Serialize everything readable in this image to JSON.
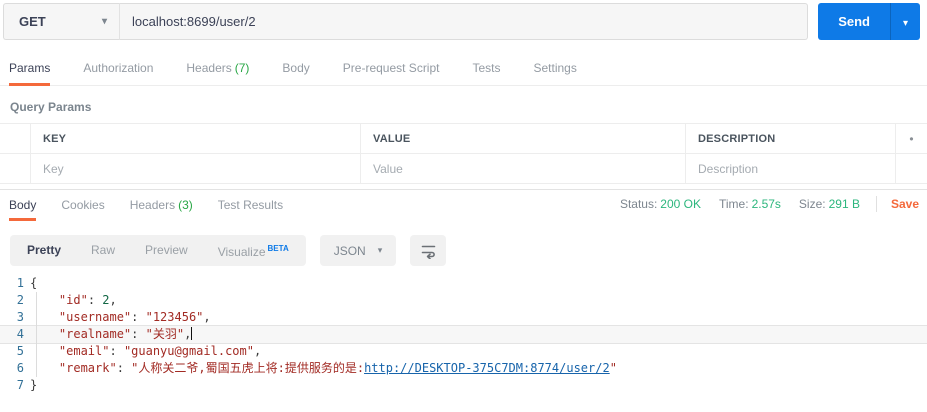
{
  "request": {
    "method": "GET",
    "url": "localhost:8699/user/2",
    "send_label": "Send",
    "tabs": [
      {
        "label": "Params",
        "active": true
      },
      {
        "label": "Authorization"
      },
      {
        "label": "Headers",
        "count": "(7)"
      },
      {
        "label": "Body"
      },
      {
        "label": "Pre-request Script"
      },
      {
        "label": "Tests"
      },
      {
        "label": "Settings"
      }
    ]
  },
  "query_params": {
    "title": "Query Params",
    "columns": {
      "key": "KEY",
      "value": "VALUE",
      "description": "DESCRIPTION"
    },
    "placeholders": {
      "key": "Key",
      "value": "Value",
      "description": "Description"
    },
    "more_icon": "•"
  },
  "response": {
    "tabs": [
      {
        "label": "Body",
        "active": true
      },
      {
        "label": "Cookies"
      },
      {
        "label": "Headers",
        "count": "(3)"
      },
      {
        "label": "Test Results"
      }
    ],
    "meta": {
      "status_label": "Status:",
      "status_value": "200 OK",
      "time_label": "Time:",
      "time_value": "2.57s",
      "size_label": "Size:",
      "size_value": "291 B",
      "save_label": "Save"
    },
    "toolbar": {
      "views": [
        {
          "label": "Pretty",
          "active": true
        },
        {
          "label": "Raw"
        },
        {
          "label": "Preview"
        },
        {
          "label": "Visualize",
          "beta": "BETA"
        }
      ],
      "language": "JSON"
    },
    "code": {
      "lines": [
        {
          "n": 1,
          "tokens": [
            {
              "c": "pun",
              "t": "{"
            }
          ]
        },
        {
          "n": 2,
          "tokens": [
            {
              "c": "ind",
              "t": "    "
            },
            {
              "c": "str",
              "t": "\"id\""
            },
            {
              "c": "pun",
              "t": ": "
            },
            {
              "c": "num",
              "t": "2"
            },
            {
              "c": "pun",
              "t": ","
            }
          ]
        },
        {
          "n": 3,
          "tokens": [
            {
              "c": "ind",
              "t": "    "
            },
            {
              "c": "str",
              "t": "\"username\""
            },
            {
              "c": "pun",
              "t": ": "
            },
            {
              "c": "str",
              "t": "\"123456\""
            },
            {
              "c": "pun",
              "t": ","
            }
          ]
        },
        {
          "n": 4,
          "active": true,
          "cursor": true,
          "tokens": [
            {
              "c": "ind",
              "t": "    "
            },
            {
              "c": "str",
              "t": "\"realname\""
            },
            {
              "c": "pun",
              "t": ": "
            },
            {
              "c": "str",
              "t": "\"关羽\""
            },
            {
              "c": "pun",
              "t": ","
            }
          ]
        },
        {
          "n": 5,
          "tokens": [
            {
              "c": "ind",
              "t": "    "
            },
            {
              "c": "str",
              "t": "\"email\""
            },
            {
              "c": "pun",
              "t": ": "
            },
            {
              "c": "str",
              "t": "\"guanyu@gmail.com\""
            },
            {
              "c": "pun",
              "t": ","
            }
          ]
        },
        {
          "n": 6,
          "tokens": [
            {
              "c": "ind",
              "t": "    "
            },
            {
              "c": "str",
              "t": "\"remark\""
            },
            {
              "c": "pun",
              "t": ": "
            },
            {
              "c": "str",
              "t": "\"人称关二爷,蜀国五虎上将:提供服务的是:"
            },
            {
              "c": "link",
              "t": "http://DESKTOP-375C7DM:8774/user/2"
            },
            {
              "c": "str",
              "t": "\""
            }
          ]
        },
        {
          "n": 7,
          "tokens": [
            {
              "c": "pun",
              "t": "}"
            }
          ]
        }
      ]
    }
  },
  "colors": {
    "accent_orange": "#f4693b",
    "accent_blue": "#0e7ae7",
    "count_green": "#29a746",
    "status_green": "#2cb67d",
    "code_string": "#a22b24",
    "code_number": "#116644",
    "code_link": "#1764ab",
    "line_number": "#337197"
  }
}
